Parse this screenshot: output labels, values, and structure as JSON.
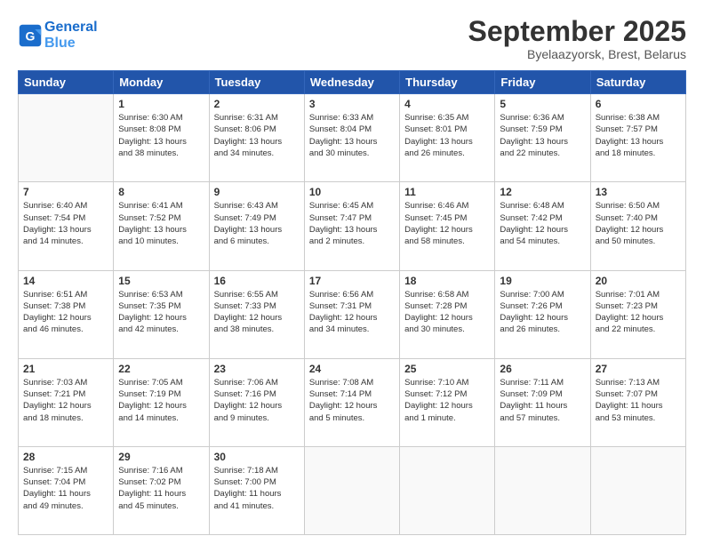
{
  "header": {
    "logo_line1": "General",
    "logo_line2": "Blue",
    "month": "September 2025",
    "location": "Byelaazyorsk, Brest, Belarus"
  },
  "weekdays": [
    "Sunday",
    "Monday",
    "Tuesday",
    "Wednesday",
    "Thursday",
    "Friday",
    "Saturday"
  ],
  "weeks": [
    [
      {
        "day": "",
        "info": ""
      },
      {
        "day": "1",
        "info": "Sunrise: 6:30 AM\nSunset: 8:08 PM\nDaylight: 13 hours\nand 38 minutes."
      },
      {
        "day": "2",
        "info": "Sunrise: 6:31 AM\nSunset: 8:06 PM\nDaylight: 13 hours\nand 34 minutes."
      },
      {
        "day": "3",
        "info": "Sunrise: 6:33 AM\nSunset: 8:04 PM\nDaylight: 13 hours\nand 30 minutes."
      },
      {
        "day": "4",
        "info": "Sunrise: 6:35 AM\nSunset: 8:01 PM\nDaylight: 13 hours\nand 26 minutes."
      },
      {
        "day": "5",
        "info": "Sunrise: 6:36 AM\nSunset: 7:59 PM\nDaylight: 13 hours\nand 22 minutes."
      },
      {
        "day": "6",
        "info": "Sunrise: 6:38 AM\nSunset: 7:57 PM\nDaylight: 13 hours\nand 18 minutes."
      }
    ],
    [
      {
        "day": "7",
        "info": "Sunrise: 6:40 AM\nSunset: 7:54 PM\nDaylight: 13 hours\nand 14 minutes."
      },
      {
        "day": "8",
        "info": "Sunrise: 6:41 AM\nSunset: 7:52 PM\nDaylight: 13 hours\nand 10 minutes."
      },
      {
        "day": "9",
        "info": "Sunrise: 6:43 AM\nSunset: 7:49 PM\nDaylight: 13 hours\nand 6 minutes."
      },
      {
        "day": "10",
        "info": "Sunrise: 6:45 AM\nSunset: 7:47 PM\nDaylight: 13 hours\nand 2 minutes."
      },
      {
        "day": "11",
        "info": "Sunrise: 6:46 AM\nSunset: 7:45 PM\nDaylight: 12 hours\nand 58 minutes."
      },
      {
        "day": "12",
        "info": "Sunrise: 6:48 AM\nSunset: 7:42 PM\nDaylight: 12 hours\nand 54 minutes."
      },
      {
        "day": "13",
        "info": "Sunrise: 6:50 AM\nSunset: 7:40 PM\nDaylight: 12 hours\nand 50 minutes."
      }
    ],
    [
      {
        "day": "14",
        "info": "Sunrise: 6:51 AM\nSunset: 7:38 PM\nDaylight: 12 hours\nand 46 minutes."
      },
      {
        "day": "15",
        "info": "Sunrise: 6:53 AM\nSunset: 7:35 PM\nDaylight: 12 hours\nand 42 minutes."
      },
      {
        "day": "16",
        "info": "Sunrise: 6:55 AM\nSunset: 7:33 PM\nDaylight: 12 hours\nand 38 minutes."
      },
      {
        "day": "17",
        "info": "Sunrise: 6:56 AM\nSunset: 7:31 PM\nDaylight: 12 hours\nand 34 minutes."
      },
      {
        "day": "18",
        "info": "Sunrise: 6:58 AM\nSunset: 7:28 PM\nDaylight: 12 hours\nand 30 minutes."
      },
      {
        "day": "19",
        "info": "Sunrise: 7:00 AM\nSunset: 7:26 PM\nDaylight: 12 hours\nand 26 minutes."
      },
      {
        "day": "20",
        "info": "Sunrise: 7:01 AM\nSunset: 7:23 PM\nDaylight: 12 hours\nand 22 minutes."
      }
    ],
    [
      {
        "day": "21",
        "info": "Sunrise: 7:03 AM\nSunset: 7:21 PM\nDaylight: 12 hours\nand 18 minutes."
      },
      {
        "day": "22",
        "info": "Sunrise: 7:05 AM\nSunset: 7:19 PM\nDaylight: 12 hours\nand 14 minutes."
      },
      {
        "day": "23",
        "info": "Sunrise: 7:06 AM\nSunset: 7:16 PM\nDaylight: 12 hours\nand 9 minutes."
      },
      {
        "day": "24",
        "info": "Sunrise: 7:08 AM\nSunset: 7:14 PM\nDaylight: 12 hours\nand 5 minutes."
      },
      {
        "day": "25",
        "info": "Sunrise: 7:10 AM\nSunset: 7:12 PM\nDaylight: 12 hours\nand 1 minute."
      },
      {
        "day": "26",
        "info": "Sunrise: 7:11 AM\nSunset: 7:09 PM\nDaylight: 11 hours\nand 57 minutes."
      },
      {
        "day": "27",
        "info": "Sunrise: 7:13 AM\nSunset: 7:07 PM\nDaylight: 11 hours\nand 53 minutes."
      }
    ],
    [
      {
        "day": "28",
        "info": "Sunrise: 7:15 AM\nSunset: 7:04 PM\nDaylight: 11 hours\nand 49 minutes."
      },
      {
        "day": "29",
        "info": "Sunrise: 7:16 AM\nSunset: 7:02 PM\nDaylight: 11 hours\nand 45 minutes."
      },
      {
        "day": "30",
        "info": "Sunrise: 7:18 AM\nSunset: 7:00 PM\nDaylight: 11 hours\nand 41 minutes."
      },
      {
        "day": "",
        "info": ""
      },
      {
        "day": "",
        "info": ""
      },
      {
        "day": "",
        "info": ""
      },
      {
        "day": "",
        "info": ""
      }
    ]
  ]
}
